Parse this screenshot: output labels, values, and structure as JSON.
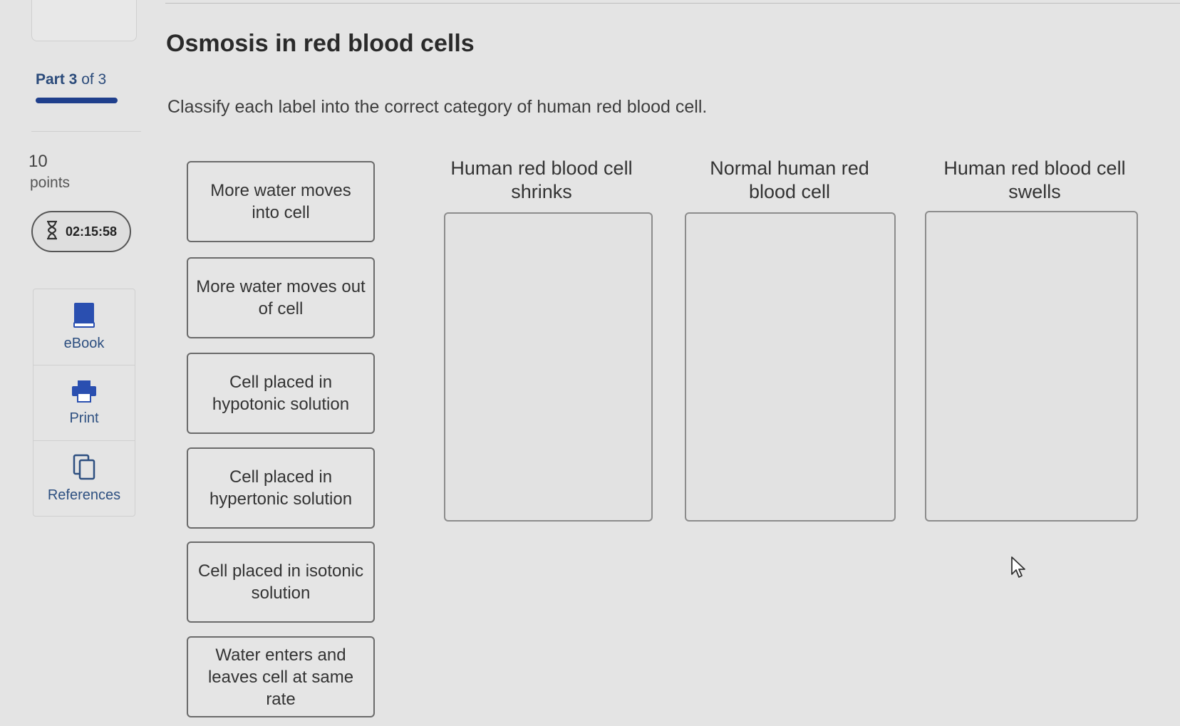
{
  "sidebar": {
    "part_prefix": "Part 3",
    "part_suffix": " of 3",
    "points_value": "10",
    "points_label": "points",
    "timer": "02:15:58",
    "tools": [
      {
        "label": "eBook",
        "icon": "book-icon"
      },
      {
        "label": "Print",
        "icon": "printer-icon"
      },
      {
        "label": "References",
        "icon": "references-icon"
      }
    ]
  },
  "question": {
    "title": "Osmosis in red blood cells",
    "instructions": "Classify each label into the correct category of human red blood cell."
  },
  "labels": [
    "More water moves into cell",
    "More water moves out of cell",
    "Cell placed in hypotonic solution",
    "Cell placed in hypertonic solution",
    "Cell placed in isotonic solution",
    "Water enters and leaves cell at same rate"
  ],
  "categories": [
    "Human red blood cell shrinks",
    "Normal human red blood cell",
    "Human red blood cell swells"
  ],
  "colors": {
    "accent": "#1f3f8c",
    "link": "#2d4f80",
    "background": "#e4e4e4"
  }
}
